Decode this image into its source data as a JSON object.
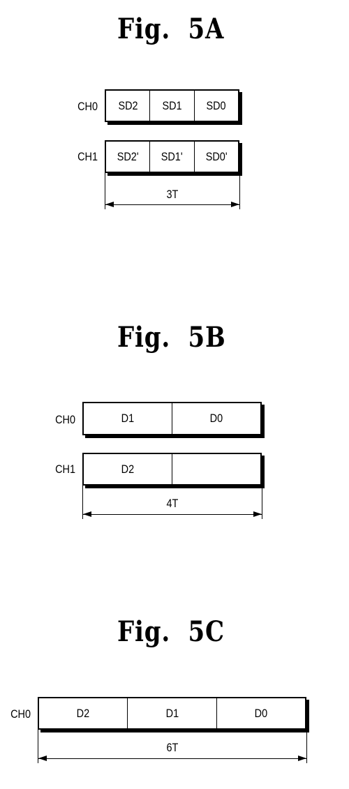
{
  "figures": [
    {
      "title": "Fig.  5A",
      "channels": [
        {
          "label": "CH0",
          "cells": [
            "SD2",
            "SD1",
            "SD0"
          ]
        },
        {
          "label": "CH1",
          "cells": [
            "SD2'",
            "SD1'",
            "SD0'"
          ]
        }
      ],
      "duration": "3T"
    },
    {
      "title": "Fig.  5B",
      "channels": [
        {
          "label": "CH0",
          "cells": [
            "D1",
            "D0"
          ]
        },
        {
          "label": "CH1",
          "cells": [
            "D2",
            ""
          ]
        }
      ],
      "duration": "4T"
    },
    {
      "title": "Fig.  5C",
      "channels": [
        {
          "label": "CH0",
          "cells": [
            "D2",
            "D1",
            "D0"
          ]
        }
      ],
      "duration": "6T"
    }
  ]
}
